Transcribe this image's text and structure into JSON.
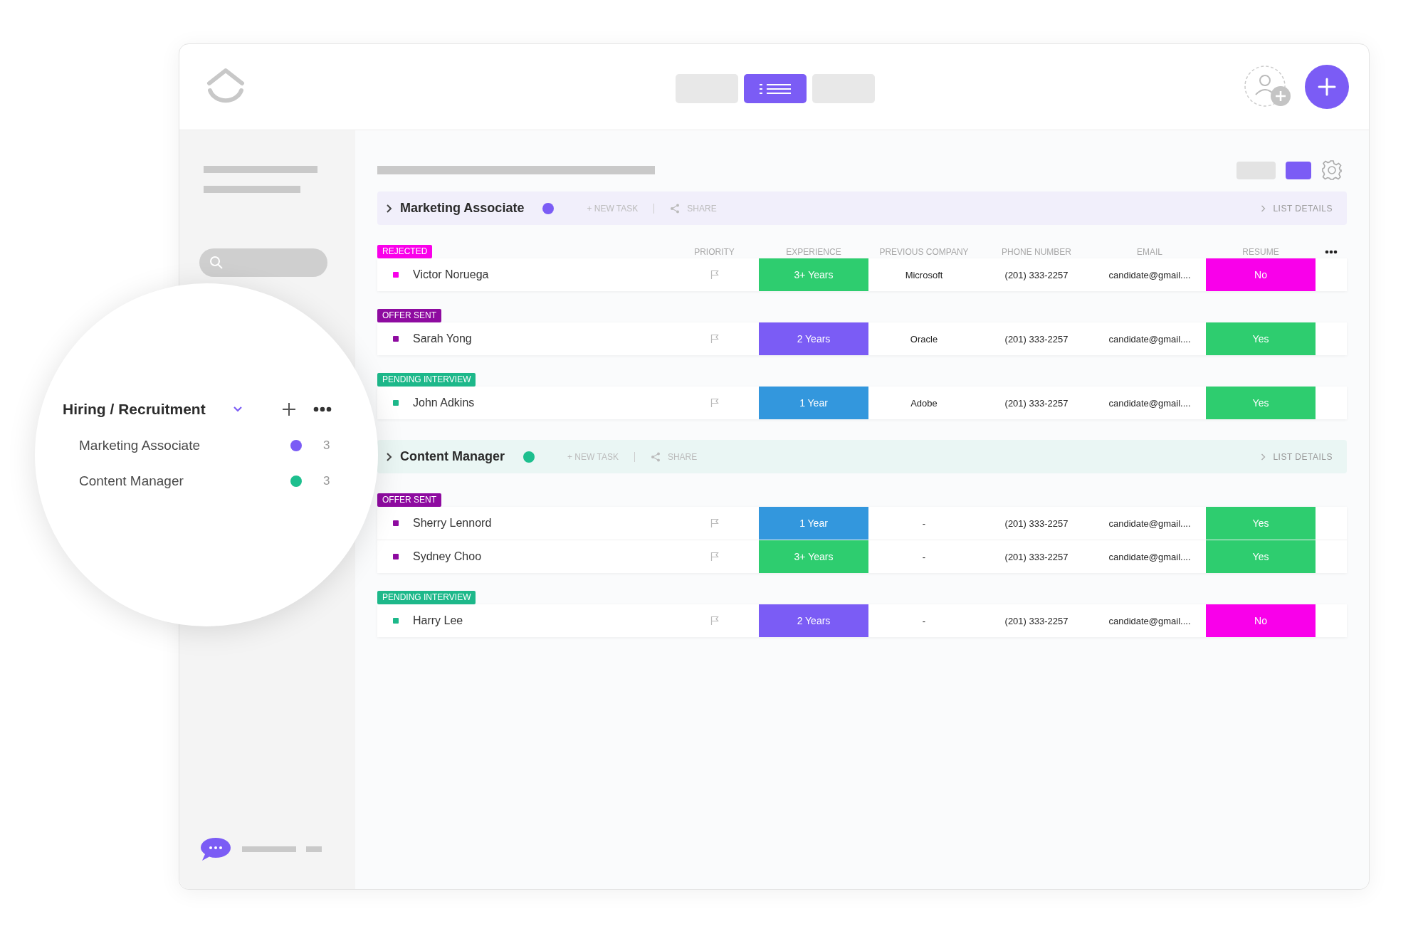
{
  "header": {
    "view_buttons": [
      {
        "kind": "blank",
        "selected": false
      },
      {
        "kind": "list",
        "selected": true
      },
      {
        "kind": "blank",
        "selected": false
      }
    ]
  },
  "sidebar": {
    "folder": {
      "title": "Hiring / Recruitment",
      "lists": [
        {
          "name": "Marketing Associate",
          "color": "#7b5cf5",
          "count": "3"
        },
        {
          "name": "Content Manager",
          "color": "#1dbf8e",
          "count": "3"
        }
      ]
    }
  },
  "groups": [
    {
      "name": "Marketing Associate",
      "color": "#7b5cf5",
      "new_task": "+ NEW TASK",
      "share": "SHARE",
      "list_details": "LIST DETAILS",
      "columns": [
        "PRIORITY",
        "EXPERIENCE",
        "PREVIOUS COMPANY",
        "PHONE NUMBER",
        "EMAIL",
        "RESUME"
      ],
      "sections": [
        {
          "status": "REJECTED",
          "color": "#f900ea",
          "rows": [
            {
              "name": "Victor Noruega",
              "experience": {
                "text": "3+ Years",
                "color": "#2ecd6f"
              },
              "company": "Microsoft",
              "phone": "(201) 333-2257",
              "email": "candidate@gmail....",
              "resume": {
                "text": "No",
                "color": "#f900ea"
              }
            }
          ]
        },
        {
          "status": "OFFER SENT",
          "color": "#8e0ba0",
          "rows": [
            {
              "name": "Sarah Yong",
              "experience": {
                "text": "2 Years",
                "color": "#7b5cf5"
              },
              "company": "Oracle",
              "phone": "(201) 333-2257",
              "email": "candidate@gmail....",
              "resume": {
                "text": "Yes",
                "color": "#2ecd6f"
              }
            }
          ]
        },
        {
          "status": "PENDING INTERVIEW",
          "color": "#1db88a",
          "rows": [
            {
              "name": "John Adkins",
              "experience": {
                "text": "1 Year",
                "color": "#3397dd"
              },
              "company": "Adobe",
              "phone": "(201) 333-2257",
              "email": "candidate@gmail....",
              "resume": {
                "text": "Yes",
                "color": "#2ecd6f"
              }
            }
          ]
        }
      ]
    },
    {
      "name": "Content Manager",
      "color": "#1dbf8e",
      "new_task": "+ NEW TASK",
      "share": "SHARE",
      "list_details": "LIST DETAILS",
      "sections": [
        {
          "status": "OFFER SENT",
          "color": "#8e0ba0",
          "rows": [
            {
              "name": "Sherry Lennord",
              "experience": {
                "text": "1 Year",
                "color": "#3397dd"
              },
              "company": "-",
              "phone": "(201) 333-2257",
              "email": "candidate@gmail....",
              "resume": {
                "text": "Yes",
                "color": "#2ecd6f"
              }
            },
            {
              "name": "Sydney Choo",
              "experience": {
                "text": "3+ Years",
                "color": "#2ecd6f"
              },
              "company": "-",
              "phone": "(201) 333-2257",
              "email": "candidate@gmail....",
              "resume": {
                "text": "Yes",
                "color": "#2ecd6f"
              }
            }
          ]
        },
        {
          "status": "PENDING INTERVIEW",
          "color": "#1db88a",
          "rows": [
            {
              "name": "Harry Lee",
              "experience": {
                "text": "2 Years",
                "color": "#7b5cf5"
              },
              "company": "-",
              "phone": "(201) 333-2257",
              "email": "candidate@gmail....",
              "resume": {
                "text": "No",
                "color": "#f900ea"
              }
            }
          ]
        }
      ]
    }
  ]
}
